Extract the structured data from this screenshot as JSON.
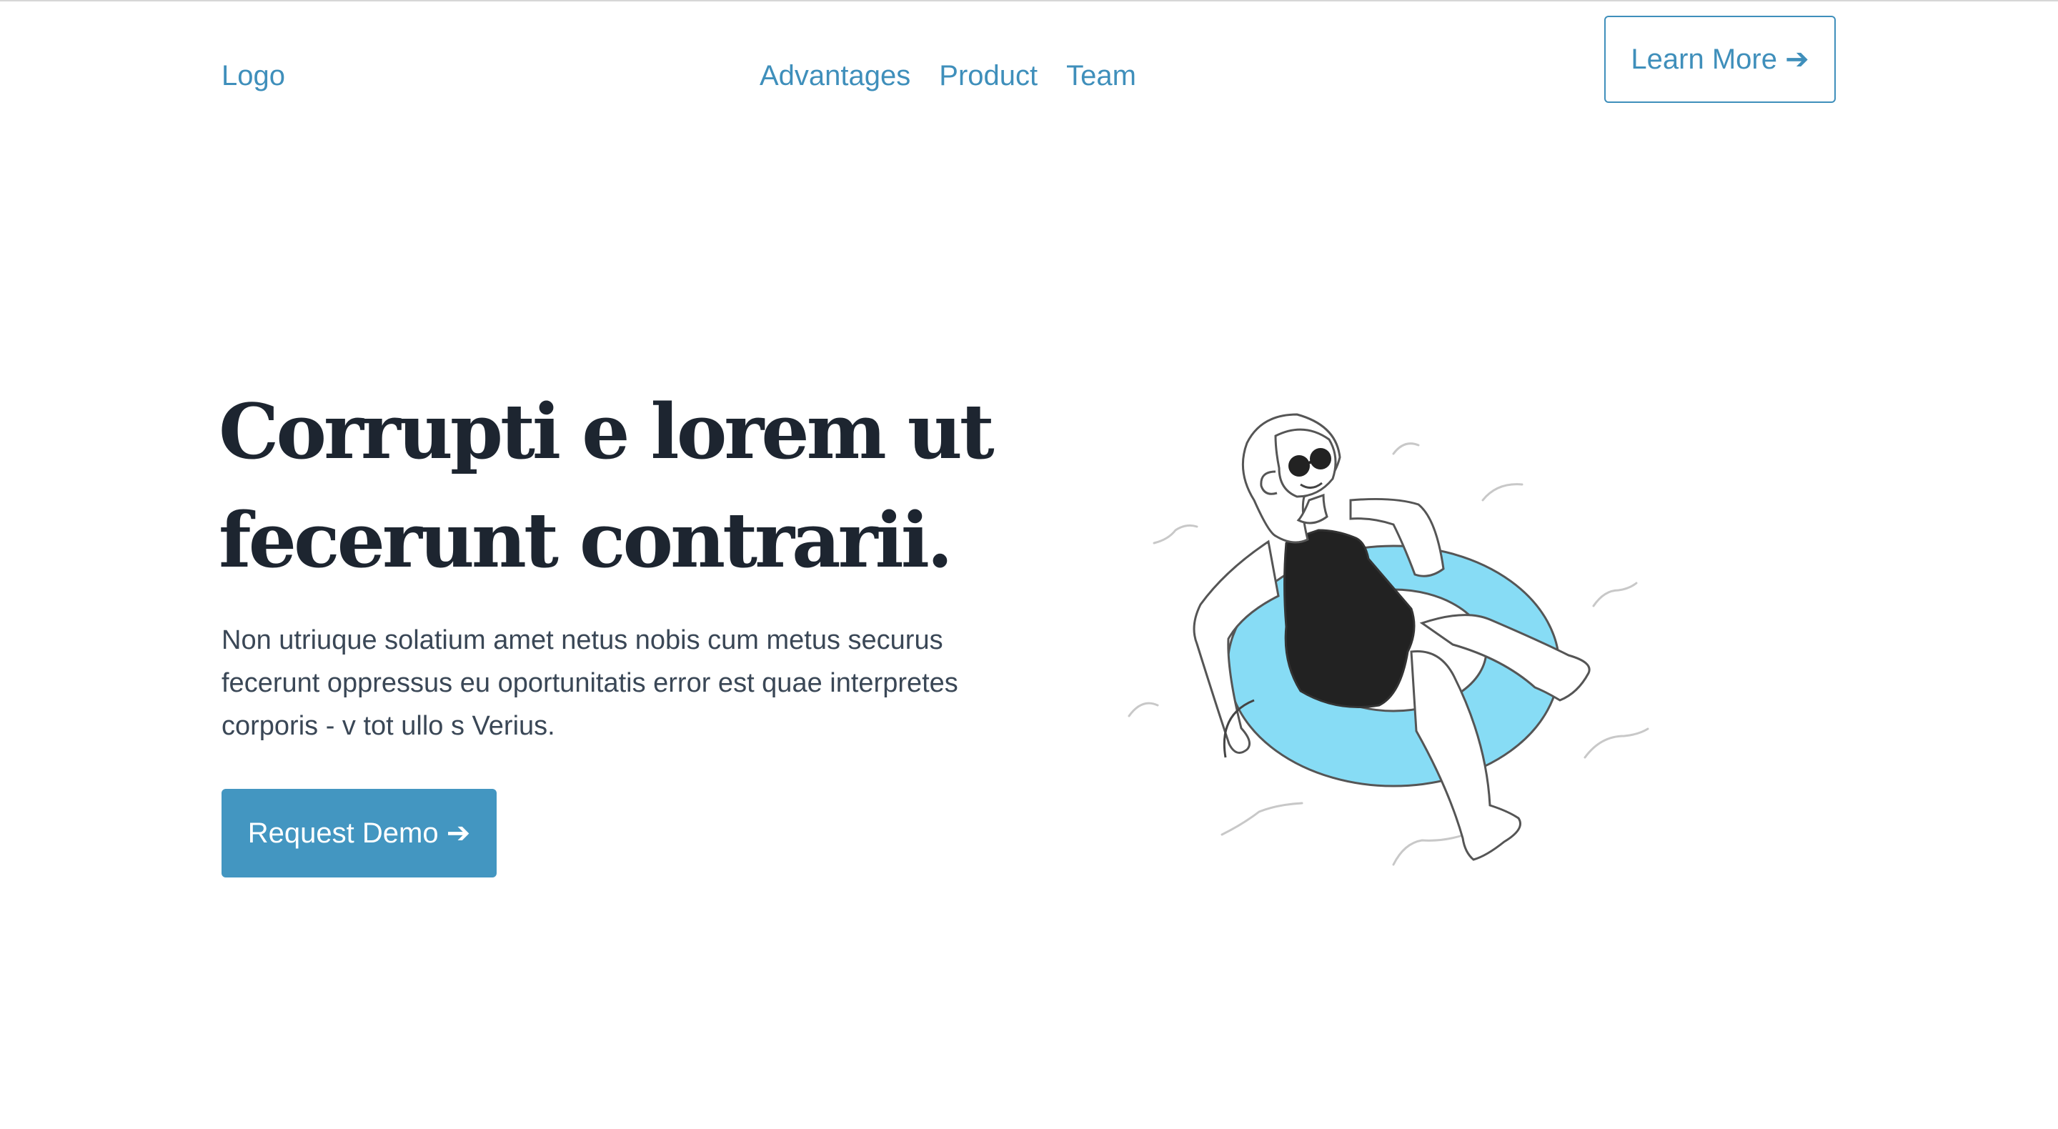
{
  "header": {
    "logo": "Logo",
    "nav": [
      "Advantages",
      "Product",
      "Team"
    ],
    "cta_label": "Learn More ➔"
  },
  "hero": {
    "title": "Corrupti e lorem ut fecerunt contrarii.",
    "description": "Non utriuque solatium amet netus nobis cum metus securus fecerunt oppressus eu oportunitatis error est quae interpretes corporis - v tot ullo s Verius.",
    "cta_label": "Request Demo ➔",
    "illustration": "woman-on-swim-ring-illustration"
  },
  "colors": {
    "accent": "#3f8fbb",
    "button_bg": "#4396c1",
    "heading": "#1d2530",
    "body_text": "#3a4756",
    "ring": "#87dcf5"
  }
}
